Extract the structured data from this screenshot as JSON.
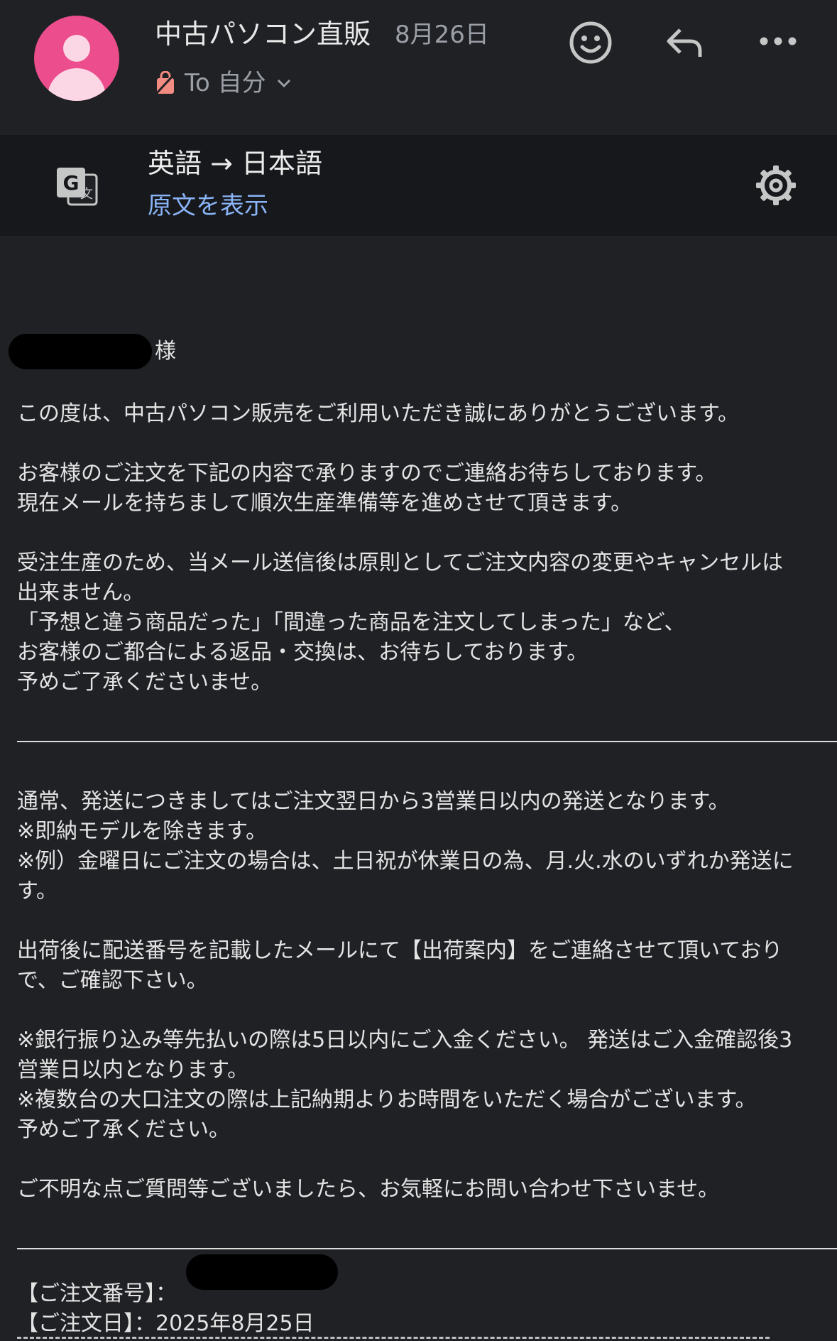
{
  "header": {
    "sender": "中古パソコン直販",
    "date": "8月26日",
    "to_label": "To 自分"
  },
  "translation": {
    "title": "英語 → 日本語",
    "show_original": "原文を表示"
  },
  "body": {
    "salutation_suffix": "様",
    "lines": [
      "この度は、中古パソコン販売をご利用いただき誠にありがとうございます。",
      "お客様のご注文を下記の内容で承りますのでご連絡お待ちしております。",
      "現在メールを持ちまして順次生産準備等を進めさせて頂きます。",
      "受注生産のため、当メール送信後は原則としてご注文内容の変更やキャンセルは",
      "出来ません。",
      "「予想と違う商品だった」「間違った商品を注文してしまった」など、",
      "お客様のご都合による返品・交換は、お待ちしております。",
      "予めご了承くださいませ。",
      "通常、発送につきましてはご注文翌日から3営業日以内の発送となります。",
      "※即納モデルを除きます。",
      "※例）金曜日にご注文の場合は、土日祝が休業日の為、月.火.水のいずれか発送に",
      "す。",
      "出荷後に配送番号を記載したメールにて【出荷案内】をご連絡させて頂いており",
      "で、ご確認下さい。",
      "※銀行振り込み等先払いの際は5日以内にご入金ください。 発送はご入金確認後3",
      "営業日以内となります。",
      "※複数台の大口注文の際は上記納期よりお時間をいただく場合がございます。",
      "予めご了承ください。",
      "ご不明な点ご質問等ございましたら、お気軽にお問い合わせ下さいませ。"
    ],
    "order_number_label": "【ご注文番号】：",
    "order_date_label": "【ご注文日】：2025年8月25日"
  }
}
